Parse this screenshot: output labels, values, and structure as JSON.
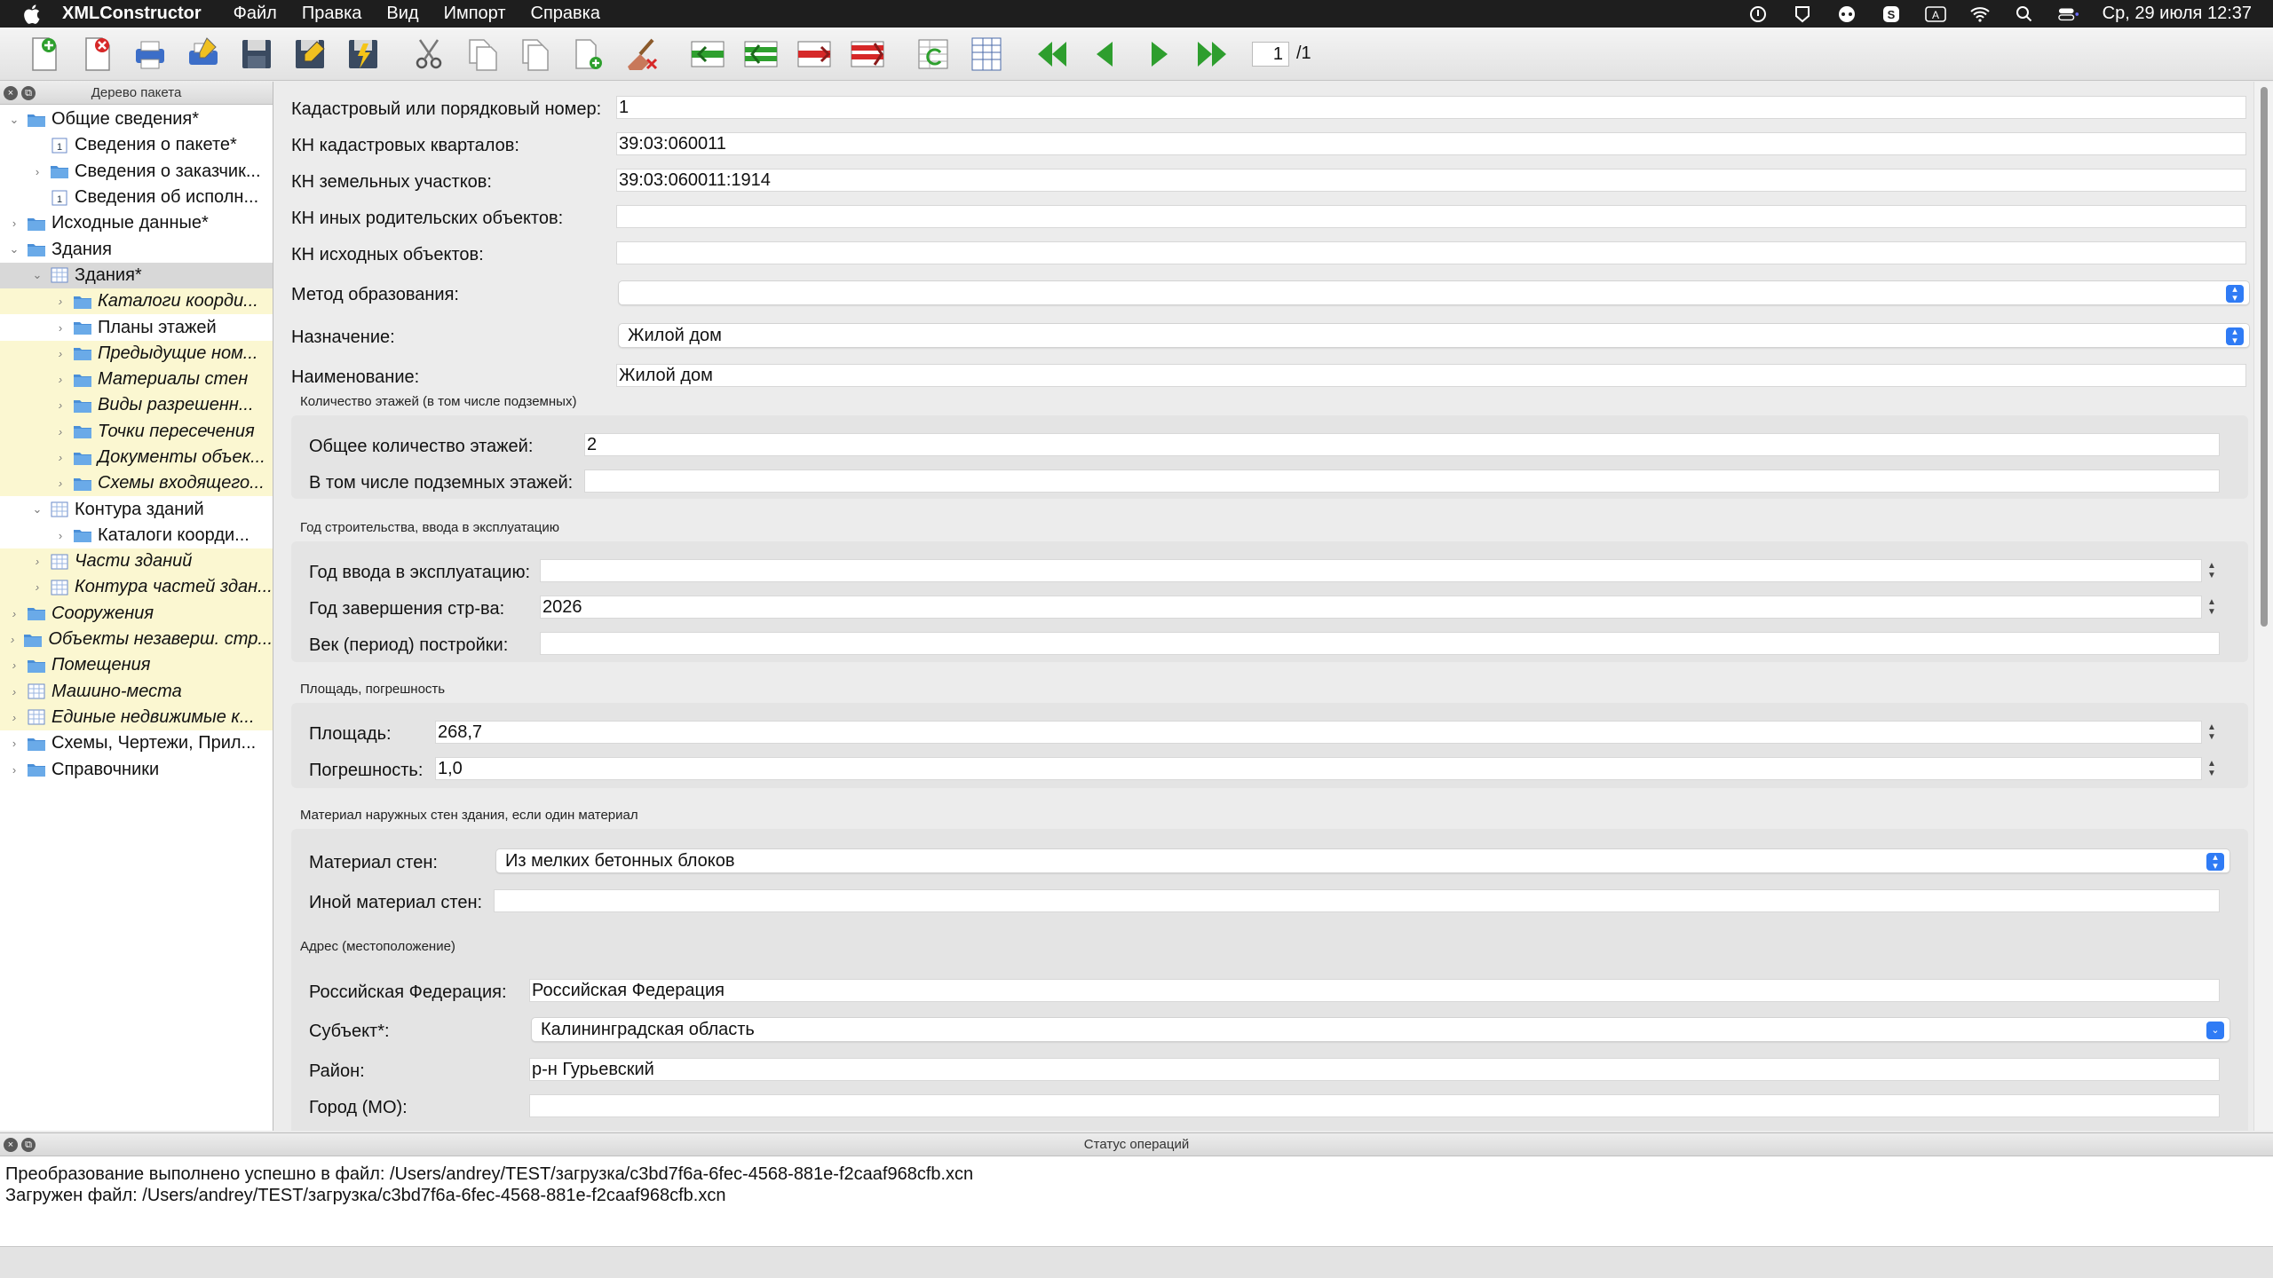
{
  "menubar": {
    "app_name": "XMLConstructor",
    "menus": [
      "Файл",
      "Правка",
      "Вид",
      "Импорт",
      "Справка"
    ],
    "clock": "Ср, 29 июля  12:37"
  },
  "toolbar": {
    "page_current": "1",
    "page_total": "/1"
  },
  "tree": {
    "header": "Дерево пакета",
    "items": [
      {
        "label": "Общие сведения*"
      },
      {
        "label": "Сведения о пакете*"
      },
      {
        "label": "Сведения о заказчик..."
      },
      {
        "label": "Сведения об исполн..."
      },
      {
        "label": "Исходные данные*"
      },
      {
        "label": "Здания"
      },
      {
        "label": "Здания*"
      },
      {
        "label": "Каталоги коорди..."
      },
      {
        "label": "Планы этажей"
      },
      {
        "label": "Предыдущие ном..."
      },
      {
        "label": "Материалы стен"
      },
      {
        "label": "Виды разрешенн..."
      },
      {
        "label": "Точки пересечения"
      },
      {
        "label": "Документы объек..."
      },
      {
        "label": "Схемы входящего..."
      },
      {
        "label": "Контура зданий"
      },
      {
        "label": "Каталоги коорди..."
      },
      {
        "label": "Части зданий"
      },
      {
        "label": "Контура частей здан..."
      },
      {
        "label": "Сооружения"
      },
      {
        "label": "Объекты незаверш. стр..."
      },
      {
        "label": "Помещения"
      },
      {
        "label": "Машино-места"
      },
      {
        "label": "Единые недвижимые к..."
      },
      {
        "label": "Схемы, Чертежи, Прил..."
      },
      {
        "label": "Справочники"
      }
    ]
  },
  "form": {
    "cadastral_number_label": "Кадастровый или порядковый номер:",
    "cadastral_number_value": "1",
    "kn_quarters_label": "КН кадастровых кварталов:",
    "kn_quarters_value": "39:03:060011",
    "kn_land_label": "КН земельных участков:",
    "kn_land_value": "39:03:060011:1914",
    "kn_parent_label": "КН иных родительских объектов:",
    "kn_parent_value": "",
    "kn_source_label": "КН исходных объектов:",
    "kn_source_value": "",
    "method_label": "Метод образования:",
    "method_value": "",
    "purpose_label": "Назначение:",
    "purpose_value": "Жилой дом",
    "name_label": "Наименование:",
    "name_value": "Жилой дом",
    "floors_group": "Количество этажей (в том числе подземных)",
    "floors_total_label": "Общее количество этажей:",
    "floors_total_value": "2",
    "floors_under_label": "В том числе подземных этажей:",
    "floors_under_value": "",
    "year_group": "Год строительства, ввода в эксплуатацию",
    "year_commission_label": "Год ввода в эксплуатацию:",
    "year_commission_value": "",
    "year_built_label": "Год завершения стр-ва:",
    "year_built_value": "2026",
    "century_label": "Век (период) постройки:",
    "century_value": "",
    "area_group": "Площадь, погрешность",
    "area_label": "Площадь:",
    "area_value": "268,7",
    "error_label": "Погрешность:",
    "error_value": "1,0",
    "wall_group": "Материал наружных стен здания, если один материал",
    "wall_label": "Материал стен:",
    "wall_value": "Из мелких бетонных блоков",
    "wall_other_label": "Иной материал стен:",
    "wall_other_value": "",
    "address_group": "Адрес (местоположение)",
    "country_label": "Российская Федерация:",
    "country_value": "Российская Федерация",
    "subject_label": "Субъект*:",
    "subject_value": "Калининградская область",
    "district_label": "Район:",
    "district_value": "р-н Гурьевский",
    "city_label": "Город (МО):",
    "city_value": ""
  },
  "status": {
    "header": "Статус операций",
    "lines": [
      "Преобразование выполнено успешно в файл: /Users/andrey/TEST/загрузка/c3bd7f6a-6fec-4568-881e-f2caaf968cfb.xcn",
      "Загружен файл: /Users/andrey/TEST/загрузка/c3bd7f6a-6fec-4568-881e-f2caaf968cfb.xcn"
    ]
  },
  "colors": {
    "accent_blue": "#2f7bf5",
    "tree_highlight": "#fbf7d1",
    "folder_blue": "#4a8fd8",
    "nav_green": "#2e9e2e"
  }
}
